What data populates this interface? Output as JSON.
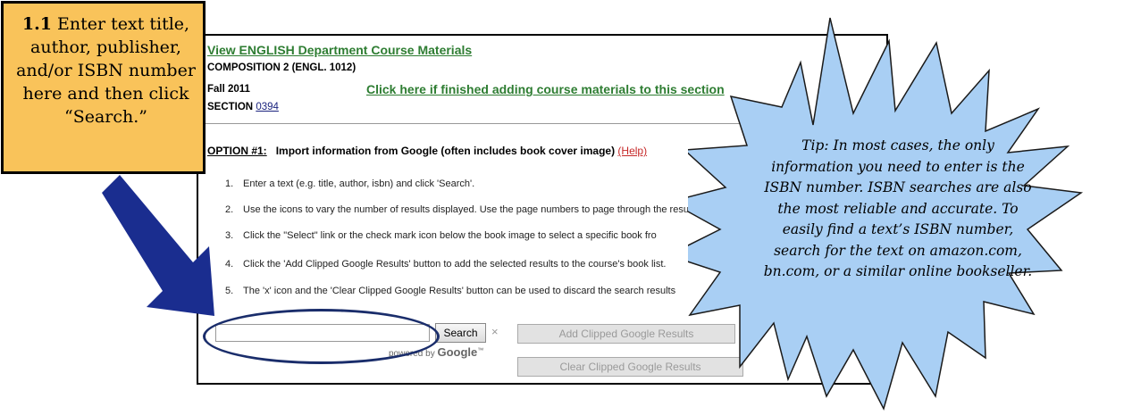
{
  "header": {
    "dept_link": "View ENGLISH  Department Course Materials",
    "course": "COMPOSITION 2 (ENGL. 1012)",
    "term": "Fall 2011",
    "section_label": "SECTION ",
    "section_number": "0394",
    "finish_link": "Click here if finished adding course materials to this section"
  },
  "option": {
    "title": "OPTION #1:",
    "text": "Import information from Google (often includes book cover image)",
    "help": "(Help)"
  },
  "steps": [
    {
      "num": "1.",
      "text": "Enter a text (e.g. title, author, isbn) and click 'Search'."
    },
    {
      "num": "2.",
      "text": "Use the icons to vary the number of results displayed. Use the page numbers to page through the results"
    },
    {
      "num": "3.",
      "text": "Click the \"Select\" link or the check mark icon below the book image to select a specific book fro"
    },
    {
      "num": "4.",
      "text": "Click the 'Add Clipped Google Results' button to add the selected results to the course's book list."
    },
    {
      "num": "5.",
      "text": "The 'x' icon and the 'Clear Clipped Google Results' button can be used to discard the search results"
    }
  ],
  "search": {
    "value": "",
    "button_label": "Search",
    "clear_icon": "×",
    "powered_by": "powered by ",
    "google_brand": "Google"
  },
  "buttons": {
    "add_clipped": "Add Clipped Google Results",
    "clear_clipped": "Clear Clipped Google Results"
  },
  "callout": {
    "step": "1.1",
    "text": " Enter text title, author, publisher, and/or ISBN number here and then click “Search.”"
  },
  "tip": {
    "text": "Tip: In most cases, the only information you need to enter is the ISBN number.  ISBN searches are also the most reliable and accurate. To easily find a text’s ISBN number, search for the text on amazon.com, bn.com, or a similar online bookseller."
  },
  "colors": {
    "link_green": "#2e7d32",
    "callout_fill": "#f9c35a",
    "star_fill": "#a9cff4",
    "arrow_blue": "#1a2d8f",
    "ellipse_navy": "#1a2d6b"
  },
  "icons": {
    "arrow": "down-right-arrow-icon",
    "clear": "close-icon"
  }
}
